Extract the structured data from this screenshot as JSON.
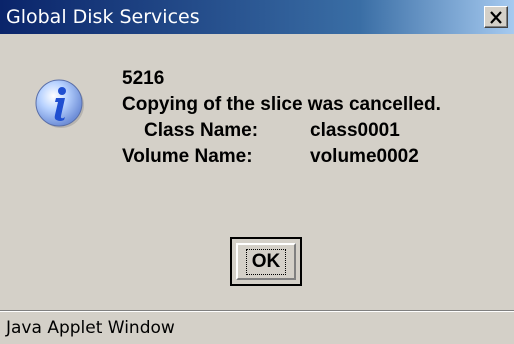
{
  "window": {
    "title": "Global Disk Services",
    "close_symbol": "×"
  },
  "icon": {
    "name": "information-icon",
    "glyph": "i",
    "color": "#1f4fd1"
  },
  "message": {
    "code": "5216",
    "text": "Copying of the slice was cancelled.",
    "class_label": "Class Name:",
    "class_value": "class0001",
    "volume_label": "Volume Name:",
    "volume_value": "volume0002"
  },
  "buttons": {
    "ok_label": "OK"
  },
  "status": {
    "text": "Java Applet Window"
  },
  "colors": {
    "titlebar_start": "#0a246a",
    "titlebar_end": "#a6caf0",
    "dialog_background": "#d4d0c8"
  }
}
